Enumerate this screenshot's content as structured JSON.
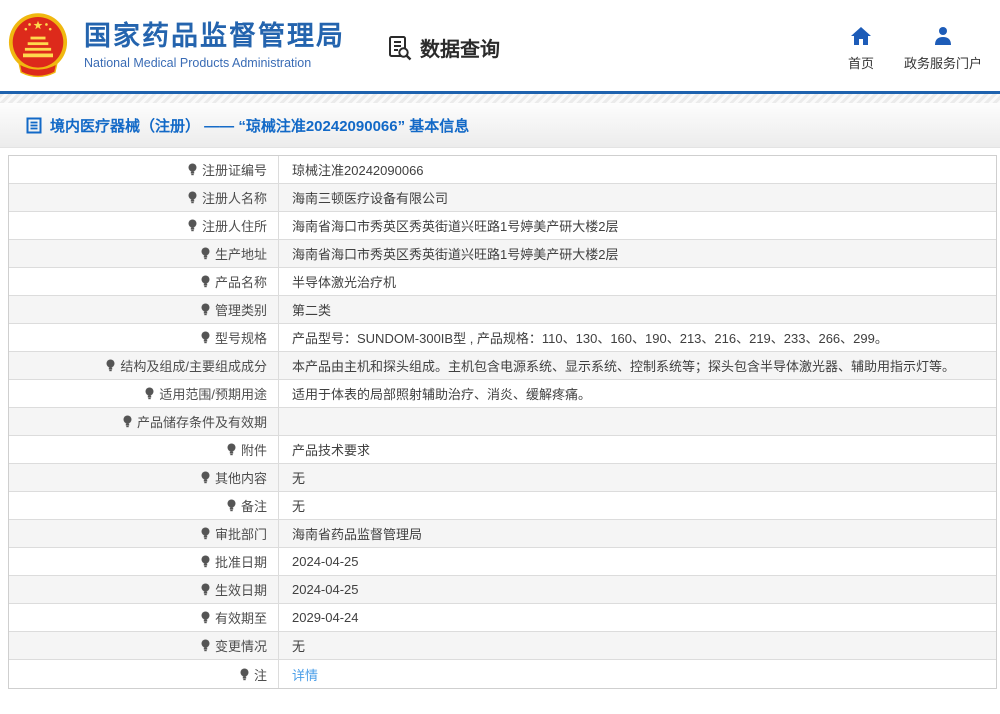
{
  "header": {
    "title": "国家药品监督管理局",
    "subtitle": "National Medical Products Administration",
    "data_query_label": "数据查询",
    "nav": [
      {
        "label": "首页",
        "icon": "home-icon"
      },
      {
        "label": "政务服务门户",
        "icon": "user-icon"
      }
    ]
  },
  "breadcrumb": {
    "text": "境内医疗器械（注册） —— “琼械注准20242090066” 基本信息"
  },
  "table": {
    "rows": [
      {
        "label": "注册证编号",
        "value": "琼械注准20242090066"
      },
      {
        "label": "注册人名称",
        "value": "海南三顿医疗设备有限公司"
      },
      {
        "label": "注册人住所",
        "value": "海南省海口市秀英区秀英街道兴旺路1号婷美产研大楼2层"
      },
      {
        "label": "生产地址",
        "value": "海南省海口市秀英区秀英街道兴旺路1号婷美产研大楼2层"
      },
      {
        "label": "产品名称",
        "value": "半导体激光治疗机"
      },
      {
        "label": "管理类别",
        "value": "第二类"
      },
      {
        "label": "型号规格",
        "value": "产品型号：SUNDOM-300IB型 , 产品规格：110、130、160、190、213、216、219、233、266、299。"
      },
      {
        "label": "结构及组成/主要组成成分",
        "value": "本产品由主机和探头组成。主机包含电源系统、显示系统、控制系统等；探头包含半导体激光器、辅助用指示灯等。"
      },
      {
        "label": "适用范围/预期用途",
        "value": "适用于体表的局部照射辅助治疗、消炎、缓解疼痛。"
      },
      {
        "label": "产品储存条件及有效期",
        "value": ""
      },
      {
        "label": "附件",
        "value": "产品技术要求"
      },
      {
        "label": "其他内容",
        "value": "无"
      },
      {
        "label": "备注",
        "value": "无"
      },
      {
        "label": "审批部门",
        "value": "海南省药品监督管理局"
      },
      {
        "label": "批准日期",
        "value": "2024-04-25"
      },
      {
        "label": "生效日期",
        "value": "2024-04-25"
      },
      {
        "label": "有效期至",
        "value": "2029-04-24"
      },
      {
        "label": "变更情况",
        "value": "无"
      },
      {
        "label": "注",
        "label_icon": "bulb-icon",
        "value": "详情",
        "link": true
      }
    ]
  },
  "colors": {
    "brand_blue": "#2464ae",
    "header_line_blue": "#1e62ae",
    "breadcrumb_blue": "#1269c7",
    "link_blue": "#4a9ee8",
    "nav_icon_blue": "#1d5cb8",
    "row_alt_bg": "#f5f5f5",
    "table_border": "#cfcfcf",
    "emblem_red": "#dd2a1b",
    "emblem_gold": "#f0b810"
  }
}
